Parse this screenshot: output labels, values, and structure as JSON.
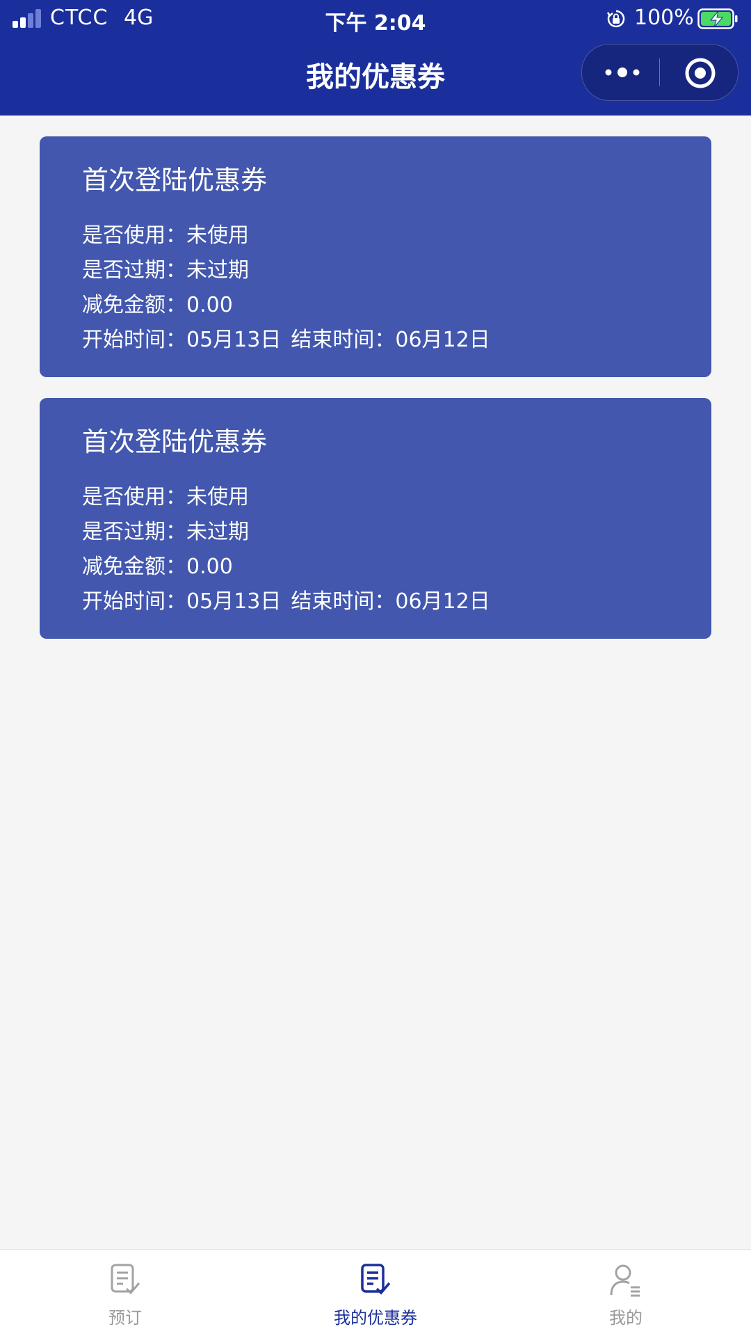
{
  "status_bar": {
    "carrier": "CTCC",
    "network": "4G",
    "time": "下午 2:04",
    "battery_percent": "100%",
    "battery_level": 1.0,
    "icons": [
      "signal-icon",
      "orientation-lock-icon",
      "battery-charging-icon"
    ]
  },
  "nav": {
    "title": "我的优惠券",
    "more_icon": "more-dots-icon",
    "close_icon": "target-icon"
  },
  "coupons": [
    {
      "title": "首次登陆优惠券",
      "used_label": "是否使用：",
      "used_value": "未使用",
      "expired_label": "是否过期：",
      "expired_value": "未过期",
      "discount_label": "减免金额：",
      "discount_value": "0.00",
      "start_label": "开始时间：",
      "start_value": "05月13日",
      "end_label": "结束时间：",
      "end_value": "06月12日"
    },
    {
      "title": "首次登陆优惠券",
      "used_label": "是否使用：",
      "used_value": "未使用",
      "expired_label": "是否过期：",
      "expired_value": "未过期",
      "discount_label": "减免金额：",
      "discount_value": "0.00",
      "start_label": "开始时间：",
      "start_value": "05月13日",
      "end_label": "结束时间：",
      "end_value": "06月12日"
    }
  ],
  "tabs": [
    {
      "label": "预订",
      "icon": "booking-icon",
      "active": false
    },
    {
      "label": "我的优惠券",
      "icon": "coupon-icon",
      "active": true
    },
    {
      "label": "我的",
      "icon": "profile-icon",
      "active": false
    }
  ],
  "colors": {
    "header_bg": "#1b2f9c",
    "card_bg": "#4257ad",
    "page_bg": "#f5f5f5",
    "tab_active": "#1b2f9c",
    "tab_inactive": "#999999"
  }
}
